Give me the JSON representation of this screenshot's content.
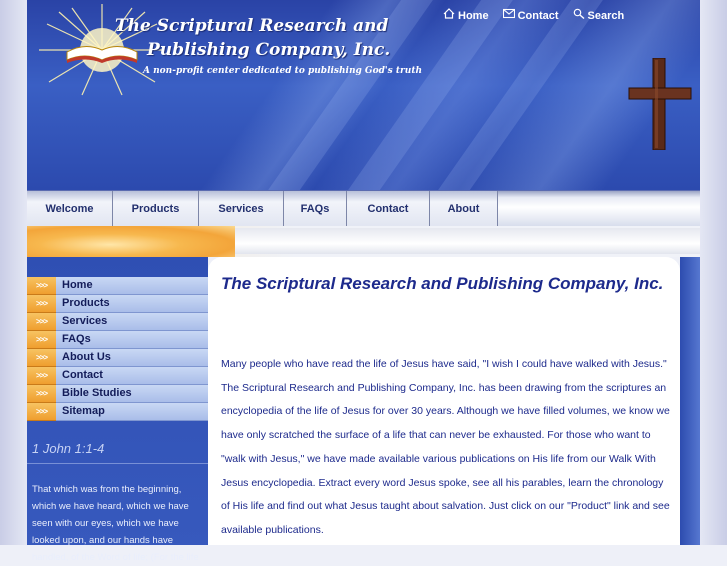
{
  "header": {
    "title_line1": "The Scriptural Research and",
    "title_line2": "Publishing Company, Inc.",
    "tagline": "A non-profit center dedicated to publishing God's truth",
    "top_links": [
      {
        "label": "Home",
        "icon": "home-icon"
      },
      {
        "label": "Contact",
        "icon": "envelope-icon"
      },
      {
        "label": "Search",
        "icon": "magnifier-icon"
      }
    ]
  },
  "nav": {
    "tabs": [
      "Welcome",
      "Products",
      "Services",
      "FAQs",
      "Contact",
      "About"
    ]
  },
  "sidebar": {
    "items": [
      {
        "label": "Home"
      },
      {
        "label": "Products"
      },
      {
        "label": "Services"
      },
      {
        "label": "FAQs"
      },
      {
        "label": "About Us"
      },
      {
        "label": "Contact"
      },
      {
        "label": "Bible Studies"
      },
      {
        "label": "Sitemap"
      }
    ],
    "arrow_glyph": ">>>",
    "verse": {
      "title": "1 John 1:1-4",
      "text": "That which was from the beginning, which we have heard, which we have seen with our eyes, which we have looked upon, and our hands have handled, of the Word of life; (For the life"
    }
  },
  "main": {
    "title": "The Scriptural Research and Publishing Company, Inc.",
    "body": "Many people who have read the life of Jesus have said, \"I wish I could have walked with Jesus.\"  The Scriptural Research and Publishing Company, Inc. has been drawing from the scriptures an encyclopedia of the life of Jesus for over 30 years. Although we have filled volumes, we know we have only scratched the surface of a life that can never be exhausted.  For those who want to \"walk with Jesus,\" we have made available various publications on His life from our Walk With Jesus encyclopedia.  Extract every word Jesus spoke, see all his parables, learn the chronology of His life and find out what Jesus taught about salvation. Just click on our \"Product\" link and see available publications."
  },
  "colors": {
    "banner_blue": "#2f4fb3",
    "accent_orange": "#f3a53a",
    "text_navy": "#1d2a8c"
  }
}
